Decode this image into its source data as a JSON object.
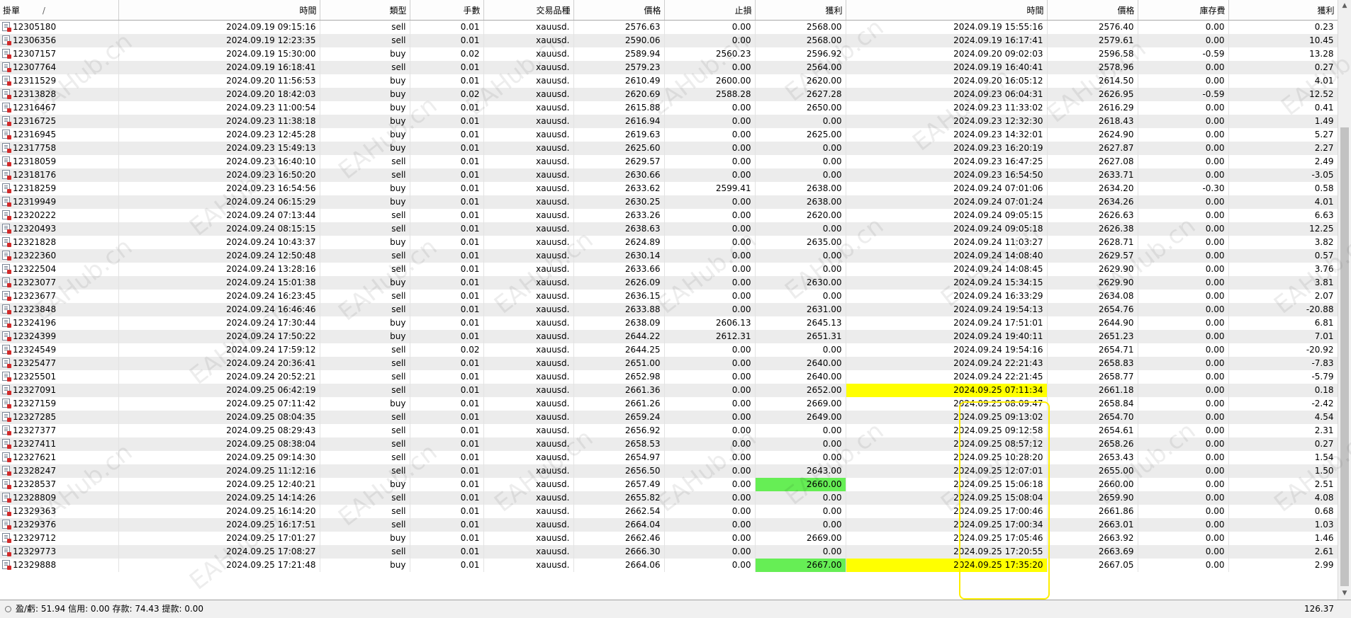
{
  "columns": [
    "掛單",
    "時間",
    "類型",
    "手數",
    "交易品種",
    "價格",
    "止損",
    "獲利",
    "時間",
    "價格",
    "庫存費",
    "獲利"
  ],
  "sort_indicator": "/",
  "rows": [
    [
      "12305180",
      "2024.09.19 09:15:16",
      "sell",
      "0.01",
      "xauusd.",
      "2576.63",
      "0.00",
      "2568.00",
      "2024.09.19 15:55:16",
      "2576.40",
      "0.00",
      "0.23"
    ],
    [
      "12306356",
      "2024.09.19 12:23:35",
      "sell",
      "0.01",
      "xauusd.",
      "2590.06",
      "0.00",
      "2568.00",
      "2024.09.19 16:17:41",
      "2579.61",
      "0.00",
      "10.45"
    ],
    [
      "12307157",
      "2024.09.19 15:30:00",
      "buy",
      "0.02",
      "xauusd.",
      "2589.94",
      "2560.23",
      "2596.92",
      "2024.09.20 09:02:03",
      "2596.58",
      "-0.59",
      "13.28"
    ],
    [
      "12307764",
      "2024.09.19 16:18:41",
      "sell",
      "0.01",
      "xauusd.",
      "2579.23",
      "0.00",
      "2564.00",
      "2024.09.19 16:40:41",
      "2578.96",
      "0.00",
      "0.27"
    ],
    [
      "12311529",
      "2024.09.20 11:56:53",
      "buy",
      "0.01",
      "xauusd.",
      "2610.49",
      "2600.00",
      "2620.00",
      "2024.09.20 16:05:12",
      "2614.50",
      "0.00",
      "4.01"
    ],
    [
      "12313828",
      "2024.09.20 18:42:03",
      "buy",
      "0.02",
      "xauusd.",
      "2620.69",
      "2588.28",
      "2627.28",
      "2024.09.23 06:04:31",
      "2626.95",
      "-0.59",
      "12.52"
    ],
    [
      "12316467",
      "2024.09.23 11:00:54",
      "buy",
      "0.01",
      "xauusd.",
      "2615.88",
      "0.00",
      "2650.00",
      "2024.09.23 11:33:02",
      "2616.29",
      "0.00",
      "0.41"
    ],
    [
      "12316725",
      "2024.09.23 11:38:18",
      "buy",
      "0.01",
      "xauusd.",
      "2616.94",
      "0.00",
      "0.00",
      "2024.09.23 12:32:30",
      "2618.43",
      "0.00",
      "1.49"
    ],
    [
      "12316945",
      "2024.09.23 12:45:28",
      "buy",
      "0.01",
      "xauusd.",
      "2619.63",
      "0.00",
      "2625.00",
      "2024.09.23 14:32:01",
      "2624.90",
      "0.00",
      "5.27"
    ],
    [
      "12317758",
      "2024.09.23 15:49:13",
      "buy",
      "0.01",
      "xauusd.",
      "2625.60",
      "0.00",
      "0.00",
      "2024.09.23 16:20:19",
      "2627.87",
      "0.00",
      "2.27"
    ],
    [
      "12318059",
      "2024.09.23 16:40:10",
      "sell",
      "0.01",
      "xauusd.",
      "2629.57",
      "0.00",
      "0.00",
      "2024.09.23 16:47:25",
      "2627.08",
      "0.00",
      "2.49"
    ],
    [
      "12318176",
      "2024.09.23 16:50:20",
      "sell",
      "0.01",
      "xauusd.",
      "2630.66",
      "0.00",
      "0.00",
      "2024.09.23 16:54:50",
      "2633.71",
      "0.00",
      "-3.05"
    ],
    [
      "12318259",
      "2024.09.23 16:54:56",
      "buy",
      "0.01",
      "xauusd.",
      "2633.62",
      "2599.41",
      "2638.00",
      "2024.09.24 07:01:06",
      "2634.20",
      "-0.30",
      "0.58"
    ],
    [
      "12319949",
      "2024.09.24 06:15:29",
      "buy",
      "0.01",
      "xauusd.",
      "2630.25",
      "0.00",
      "2638.00",
      "2024.09.24 07:01:24",
      "2634.26",
      "0.00",
      "4.01"
    ],
    [
      "12320222",
      "2024.09.24 07:13:44",
      "sell",
      "0.01",
      "xauusd.",
      "2633.26",
      "0.00",
      "2620.00",
      "2024.09.24 09:05:15",
      "2626.63",
      "0.00",
      "6.63"
    ],
    [
      "12320493",
      "2024.09.24 08:15:15",
      "sell",
      "0.01",
      "xauusd.",
      "2638.63",
      "0.00",
      "0.00",
      "2024.09.24 09:05:18",
      "2626.38",
      "0.00",
      "12.25"
    ],
    [
      "12321828",
      "2024.09.24 10:43:37",
      "buy",
      "0.01",
      "xauusd.",
      "2624.89",
      "0.00",
      "2635.00",
      "2024.09.24 11:03:27",
      "2628.71",
      "0.00",
      "3.82"
    ],
    [
      "12322360",
      "2024.09.24 12:50:48",
      "sell",
      "0.01",
      "xauusd.",
      "2630.14",
      "0.00",
      "0.00",
      "2024.09.24 14:08:40",
      "2629.57",
      "0.00",
      "0.57"
    ],
    [
      "12322504",
      "2024.09.24 13:28:16",
      "sell",
      "0.01",
      "xauusd.",
      "2633.66",
      "0.00",
      "0.00",
      "2024.09.24 14:08:45",
      "2629.90",
      "0.00",
      "3.76"
    ],
    [
      "12323077",
      "2024.09.24 15:01:38",
      "buy",
      "0.01",
      "xauusd.",
      "2626.09",
      "0.00",
      "2630.00",
      "2024.09.24 15:34:15",
      "2629.90",
      "0.00",
      "3.81"
    ],
    [
      "12323677",
      "2024.09.24 16:23:45",
      "sell",
      "0.01",
      "xauusd.",
      "2636.15",
      "0.00",
      "0.00",
      "2024.09.24 16:33:29",
      "2634.08",
      "0.00",
      "2.07"
    ],
    [
      "12323848",
      "2024.09.24 16:46:46",
      "sell",
      "0.01",
      "xauusd.",
      "2633.88",
      "0.00",
      "2631.00",
      "2024.09.24 19:54:13",
      "2654.76",
      "0.00",
      "-20.88"
    ],
    [
      "12324196",
      "2024.09.24 17:30:44",
      "buy",
      "0.01",
      "xauusd.",
      "2638.09",
      "2606.13",
      "2645.13",
      "2024.09.24 17:51:01",
      "2644.90",
      "0.00",
      "6.81"
    ],
    [
      "12324399",
      "2024.09.24 17:50:22",
      "buy",
      "0.01",
      "xauusd.",
      "2644.22",
      "2612.31",
      "2651.31",
      "2024.09.24 19:40:11",
      "2651.23",
      "0.00",
      "7.01"
    ],
    [
      "12324549",
      "2024.09.24 17:59:12",
      "sell",
      "0.02",
      "xauusd.",
      "2644.25",
      "0.00",
      "0.00",
      "2024.09.24 19:54:16",
      "2654.71",
      "0.00",
      "-20.92"
    ],
    [
      "12325477",
      "2024.09.24 20:36:41",
      "sell",
      "0.01",
      "xauusd.",
      "2651.00",
      "0.00",
      "2640.00",
      "2024.09.24 22:21:43",
      "2658.83",
      "0.00",
      "-7.83"
    ],
    [
      "12325501",
      "2024.09.24 20:52:21",
      "sell",
      "0.01",
      "xauusd.",
      "2652.98",
      "0.00",
      "2640.00",
      "2024.09.24 22:21:45",
      "2658.77",
      "0.00",
      "-5.79"
    ],
    [
      "12327091",
      "2024.09.25 06:42:19",
      "sell",
      "0.01",
      "xauusd.",
      "2661.36",
      "0.00",
      "2652.00",
      "2024.09.25 07:11:34",
      "2661.18",
      "0.00",
      "0.18"
    ],
    [
      "12327159",
      "2024.09.25 07:11:42",
      "buy",
      "0.01",
      "xauusd.",
      "2661.26",
      "0.00",
      "2669.00",
      "2024.09.25 08:09:47",
      "2658.84",
      "0.00",
      "-2.42"
    ],
    [
      "12327285",
      "2024.09.25 08:04:35",
      "sell",
      "0.01",
      "xauusd.",
      "2659.24",
      "0.00",
      "2649.00",
      "2024.09.25 09:13:02",
      "2654.70",
      "0.00",
      "4.54"
    ],
    [
      "12327377",
      "2024.09.25 08:29:43",
      "sell",
      "0.01",
      "xauusd.",
      "2656.92",
      "0.00",
      "0.00",
      "2024.09.25 09:12:58",
      "2654.61",
      "0.00",
      "2.31"
    ],
    [
      "12327411",
      "2024.09.25 08:38:04",
      "sell",
      "0.01",
      "xauusd.",
      "2658.53",
      "0.00",
      "0.00",
      "2024.09.25 08:57:12",
      "2658.26",
      "0.00",
      "0.27"
    ],
    [
      "12327621",
      "2024.09.25 09:14:30",
      "sell",
      "0.01",
      "xauusd.",
      "2654.97",
      "0.00",
      "0.00",
      "2024.09.25 10:28:20",
      "2653.43",
      "0.00",
      "1.54"
    ],
    [
      "12328247",
      "2024.09.25 11:12:16",
      "sell",
      "0.01",
      "xauusd.",
      "2656.50",
      "0.00",
      "2643.00",
      "2024.09.25 12:07:01",
      "2655.00",
      "0.00",
      "1.50"
    ],
    [
      "12328537",
      "2024.09.25 12:40:21",
      "buy",
      "0.01",
      "xauusd.",
      "2657.49",
      "0.00",
      "2660.00",
      "2024.09.25 15:06:18",
      "2660.00",
      "0.00",
      "2.51"
    ],
    [
      "12328809",
      "2024.09.25 14:14:26",
      "sell",
      "0.01",
      "xauusd.",
      "2655.82",
      "0.00",
      "0.00",
      "2024.09.25 15:08:04",
      "2659.90",
      "0.00",
      "4.08"
    ],
    [
      "12329363",
      "2024.09.25 16:14:20",
      "sell",
      "0.01",
      "xauusd.",
      "2662.54",
      "0.00",
      "0.00",
      "2024.09.25 17:00:46",
      "2661.86",
      "0.00",
      "0.68"
    ],
    [
      "12329376",
      "2024.09.25 16:17:51",
      "sell",
      "0.01",
      "xauusd.",
      "2664.04",
      "0.00",
      "0.00",
      "2024.09.25 17:00:34",
      "2663.01",
      "0.00",
      "1.03"
    ],
    [
      "12329712",
      "2024.09.25 17:01:27",
      "buy",
      "0.01",
      "xauusd.",
      "2662.46",
      "0.00",
      "2669.00",
      "2024.09.25 17:05:46",
      "2663.92",
      "0.00",
      "1.46"
    ],
    [
      "12329773",
      "2024.09.25 17:08:27",
      "sell",
      "0.01",
      "xauusd.",
      "2666.30",
      "0.00",
      "0.00",
      "2024.09.25 17:20:55",
      "2663.69",
      "0.00",
      "2.61"
    ],
    [
      "12329888",
      "2024.09.25 17:21:48",
      "buy",
      "0.01",
      "xauusd.",
      "2664.06",
      "0.00",
      "2667.00",
      "2024.09.25 17:35:20",
      "2667.05",
      "0.00",
      "2.99"
    ]
  ],
  "highlights": {
    "green_cells": [
      [
        34,
        7
      ],
      [
        40,
        7
      ]
    ],
    "yellow_cells": [
      [
        27,
        8
      ],
      [
        40,
        8
      ]
    ],
    "green_color": "#66ee55",
    "yellow_color": "#ffff00",
    "outline_color": "#ffee00"
  },
  "status": {
    "text": "盈/虧: 51.94  信用: 0.00  存款: 74.43  提款: 0.00",
    "total": "126.37"
  },
  "watermark": "EAHub.cn",
  "icons": {
    "order_icon": "sell-order-document-icon",
    "status_icon": "circle-icon",
    "scroll_up": "scroll-up-arrow-icon",
    "scroll_down": "scroll-down-arrow-icon"
  }
}
